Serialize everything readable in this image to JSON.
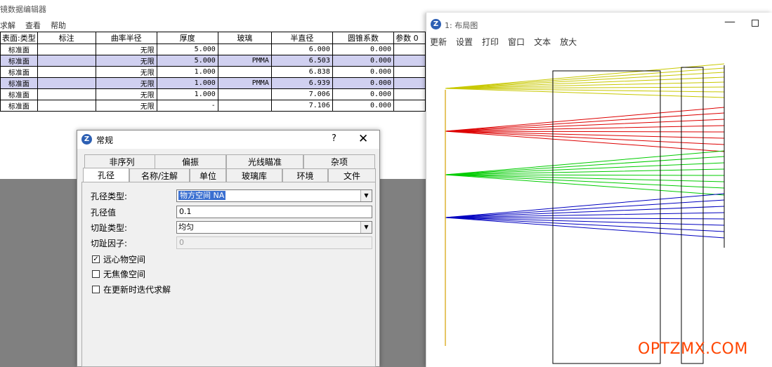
{
  "lens_editor": {
    "title": "镜数据编辑器",
    "menu": [
      "求解",
      "查看",
      "帮助"
    ],
    "columns": [
      "表面:类型",
      "标注",
      "曲率半径",
      "厚度",
      "玻璃",
      "半直径",
      "圆锥系数",
      "参数 0"
    ],
    "rows": [
      {
        "type": "标准面",
        "comment": "",
        "radius": "无限",
        "thickness": "5.000",
        "glass": "",
        "semi_diameter": "6.000",
        "conic": "0.000",
        "highlight": false
      },
      {
        "type": "标准面",
        "comment": "",
        "radius": "无限",
        "thickness": "5.000",
        "glass": "PMMA",
        "semi_diameter": "6.503",
        "conic": "0.000",
        "highlight": true
      },
      {
        "type": "标准面",
        "comment": "",
        "radius": "无限",
        "thickness": "1.000",
        "glass": "",
        "semi_diameter": "6.838",
        "conic": "0.000",
        "highlight": false
      },
      {
        "type": "标准面",
        "comment": "",
        "radius": "无限",
        "thickness": "1.000",
        "glass": "PMMA",
        "semi_diameter": "6.939",
        "conic": "0.000",
        "highlight": true
      },
      {
        "type": "标准面",
        "comment": "",
        "radius": "无限",
        "thickness": "1.000",
        "glass": "",
        "semi_diameter": "7.006",
        "conic": "0.000",
        "highlight": false
      },
      {
        "type": "标准面",
        "comment": "",
        "radius": "无限",
        "thickness": "-",
        "glass": "",
        "semi_diameter": "7.106",
        "conic": "0.000",
        "highlight": false
      }
    ]
  },
  "dialog": {
    "title": "常规",
    "help": "?",
    "close": "✕",
    "tabs_row1": [
      "非序列",
      "偏振",
      "光线瞄准",
      "杂项"
    ],
    "tabs_row2": [
      "孔径",
      "名称/注解",
      "单位",
      "玻璃库",
      "环境",
      "文件"
    ],
    "active_tab": "孔径",
    "fields": {
      "aperture_type_label": "孔径类型:",
      "aperture_type_value": "物方空间 NA",
      "aperture_value_label": "孔径值",
      "aperture_value": "0.1",
      "apodization_type_label": "切趾类型:",
      "apodization_type_value": "均匀",
      "apodization_factor_label": "切趾因子:",
      "apodization_factor_value": "0"
    },
    "checkboxes": [
      {
        "label": "远心物空间",
        "checked": true
      },
      {
        "label": "无焦像空间",
        "checked": false
      },
      {
        "label": "在更新时迭代求解",
        "checked": false
      }
    ]
  },
  "layout_window": {
    "title": "1: 布局图",
    "menu": [
      "更新",
      "设置",
      "打印",
      "窗口",
      "文本",
      "放大"
    ],
    "ray_colors": {
      "field1": "#c8c800",
      "field2": "#dd0000",
      "field3": "#00cc00",
      "field4": "#0000c0",
      "object": "#d4a000"
    }
  },
  "watermark": "OPTZMX.COM"
}
